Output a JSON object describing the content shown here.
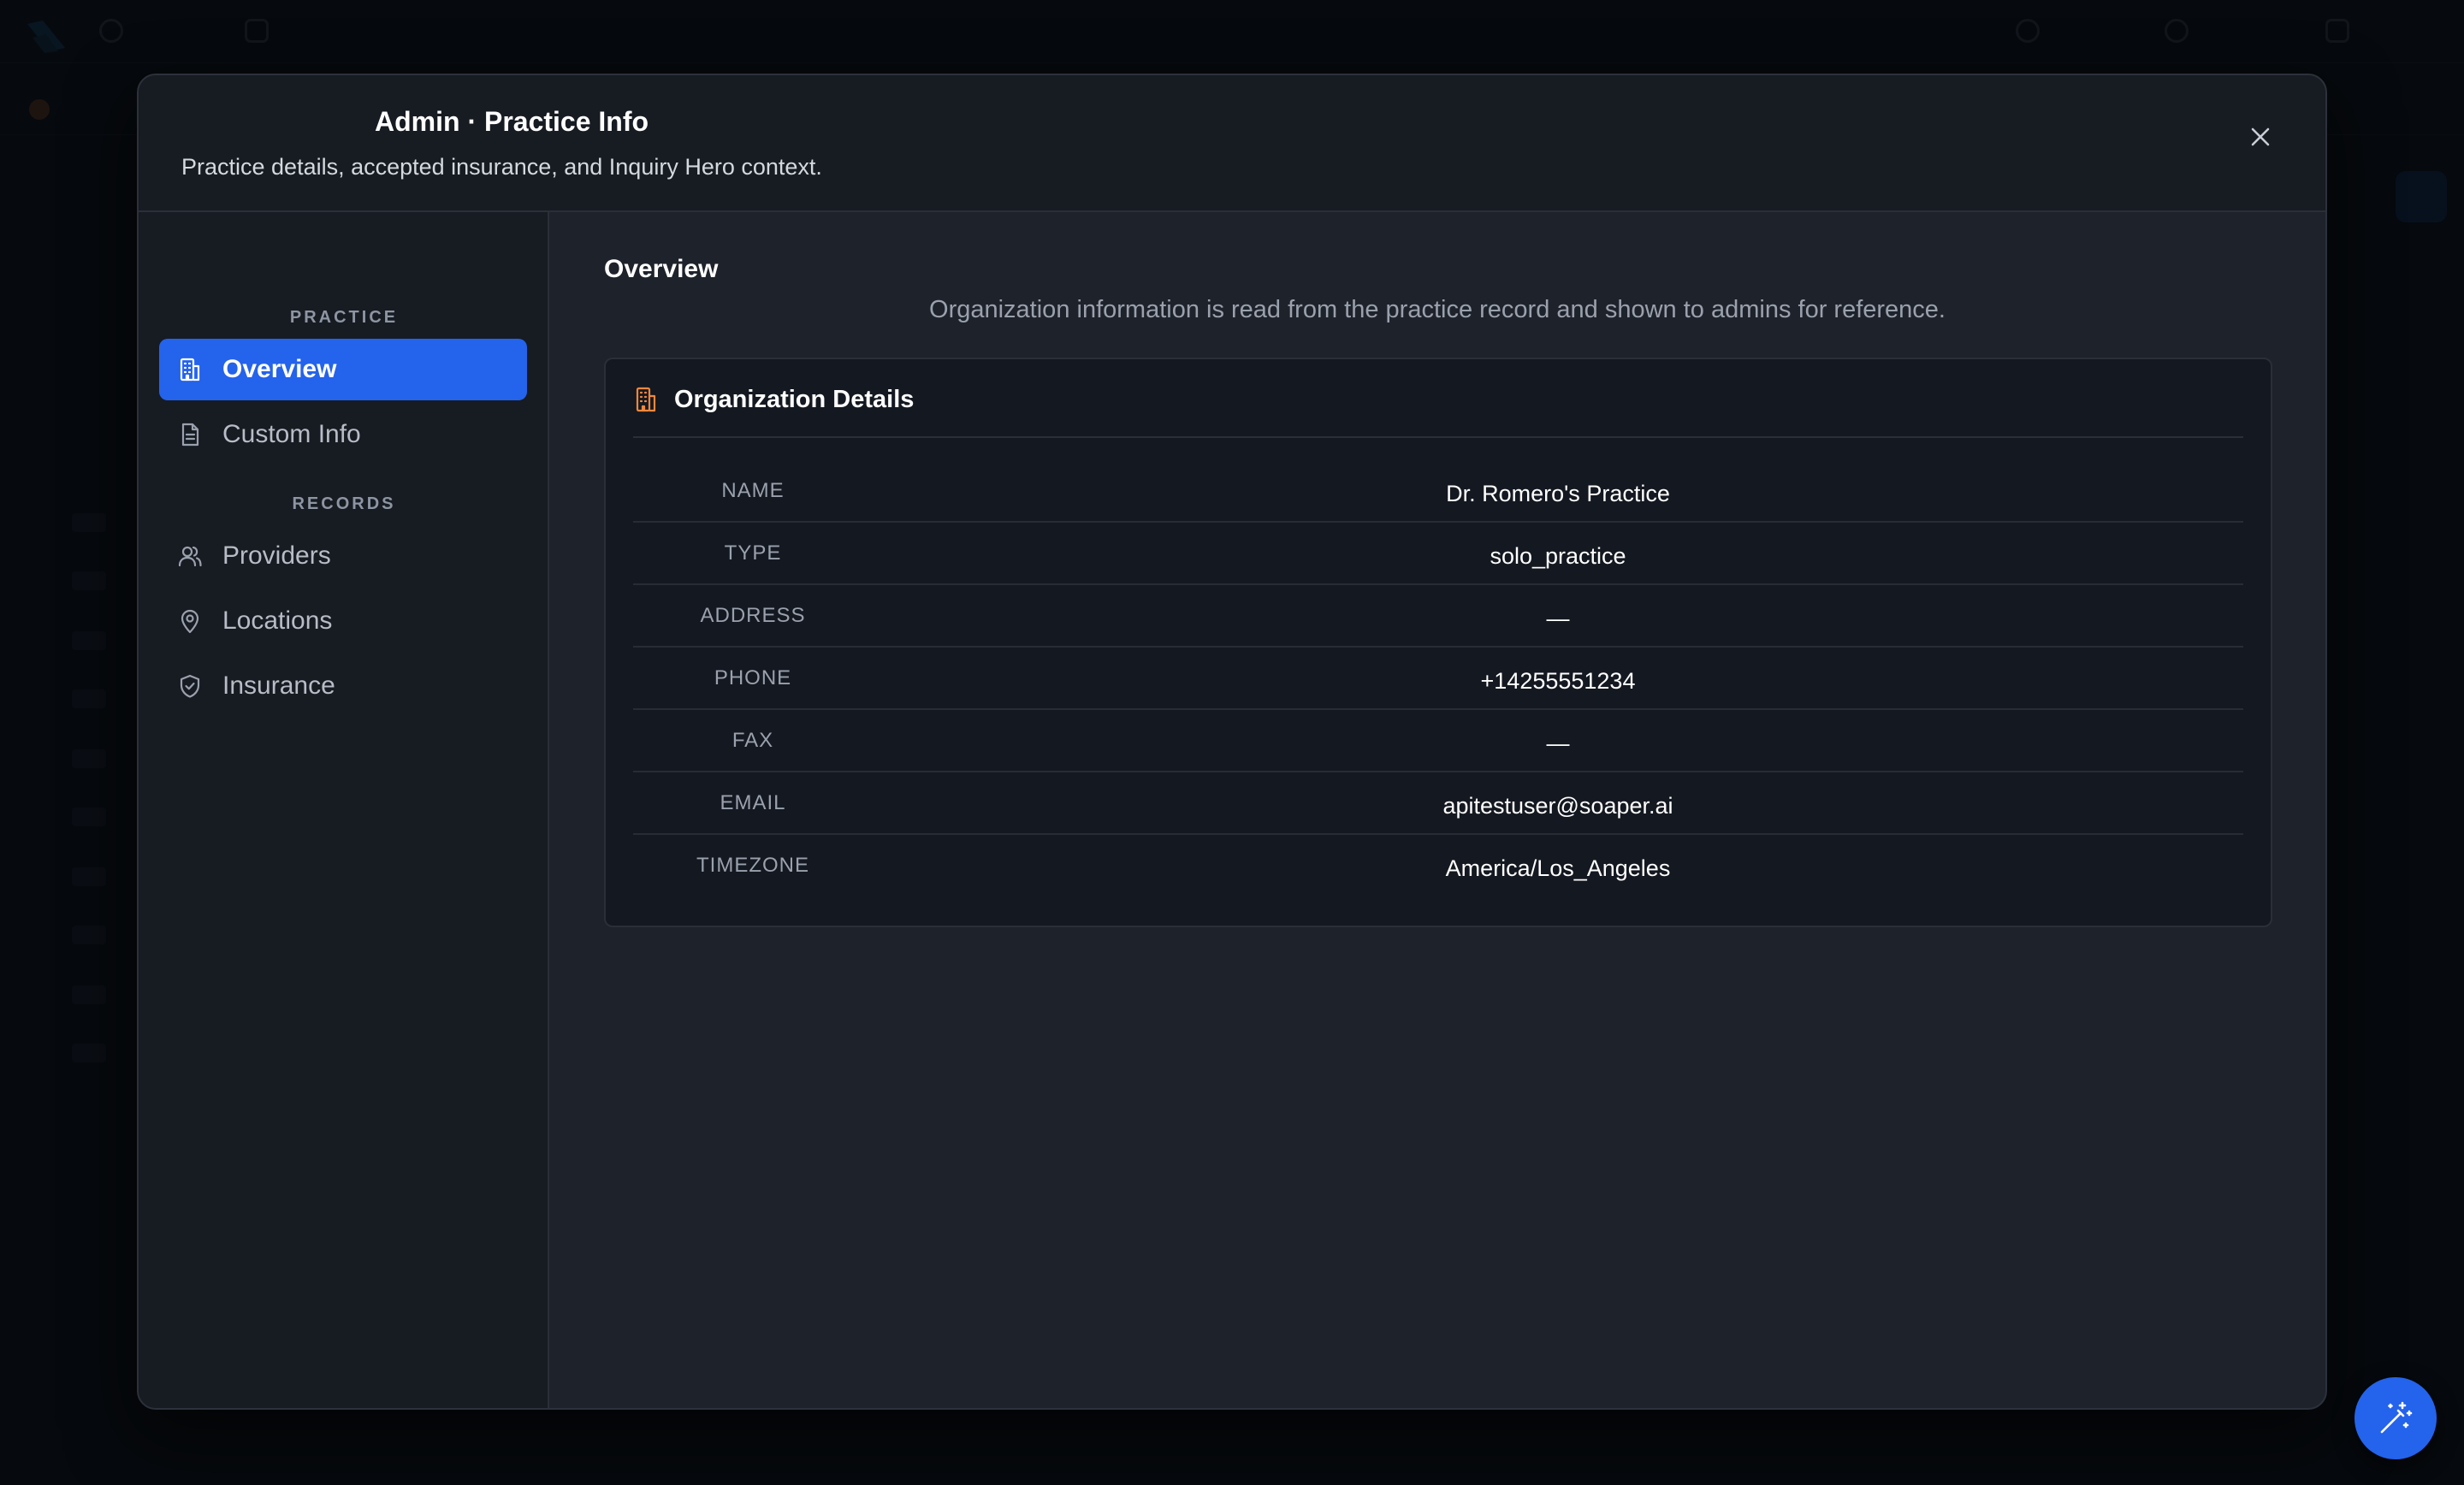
{
  "modal": {
    "title": "Admin · Practice Info",
    "subtitle": "Practice details, accepted insurance, and Inquiry Hero context."
  },
  "sidebar": {
    "sections": [
      {
        "label": "PRACTICE",
        "items": [
          {
            "label": "Overview",
            "icon": "building-icon",
            "active": true
          },
          {
            "label": "Custom Info",
            "icon": "document-icon",
            "active": false
          }
        ]
      },
      {
        "label": "RECORDS",
        "items": [
          {
            "label": "Providers",
            "icon": "users-icon",
            "active": false
          },
          {
            "label": "Locations",
            "icon": "map-pin-icon",
            "active": false
          },
          {
            "label": "Insurance",
            "icon": "shield-icon",
            "active": false
          }
        ]
      }
    ]
  },
  "content": {
    "title": "Overview",
    "description": "Organization information is read from the practice record and shown to admins for reference.",
    "card": {
      "title": "Organization Details",
      "icon": "building-icon",
      "rows": [
        {
          "key": "NAME",
          "value": "Dr. Romero's Practice"
        },
        {
          "key": "TYPE",
          "value": "solo_practice"
        },
        {
          "key": "ADDRESS",
          "value": "—"
        },
        {
          "key": "PHONE",
          "value": "+14255551234"
        },
        {
          "key": "FAX",
          "value": "—"
        },
        {
          "key": "EMAIL",
          "value": "apitestuser@soaper.ai"
        },
        {
          "key": "TIMEZONE",
          "value": "America/Los_Angeles"
        }
      ]
    }
  },
  "colors": {
    "accent": "#2463eb",
    "card_icon": "#f0883e",
    "background": "#1e222a"
  }
}
